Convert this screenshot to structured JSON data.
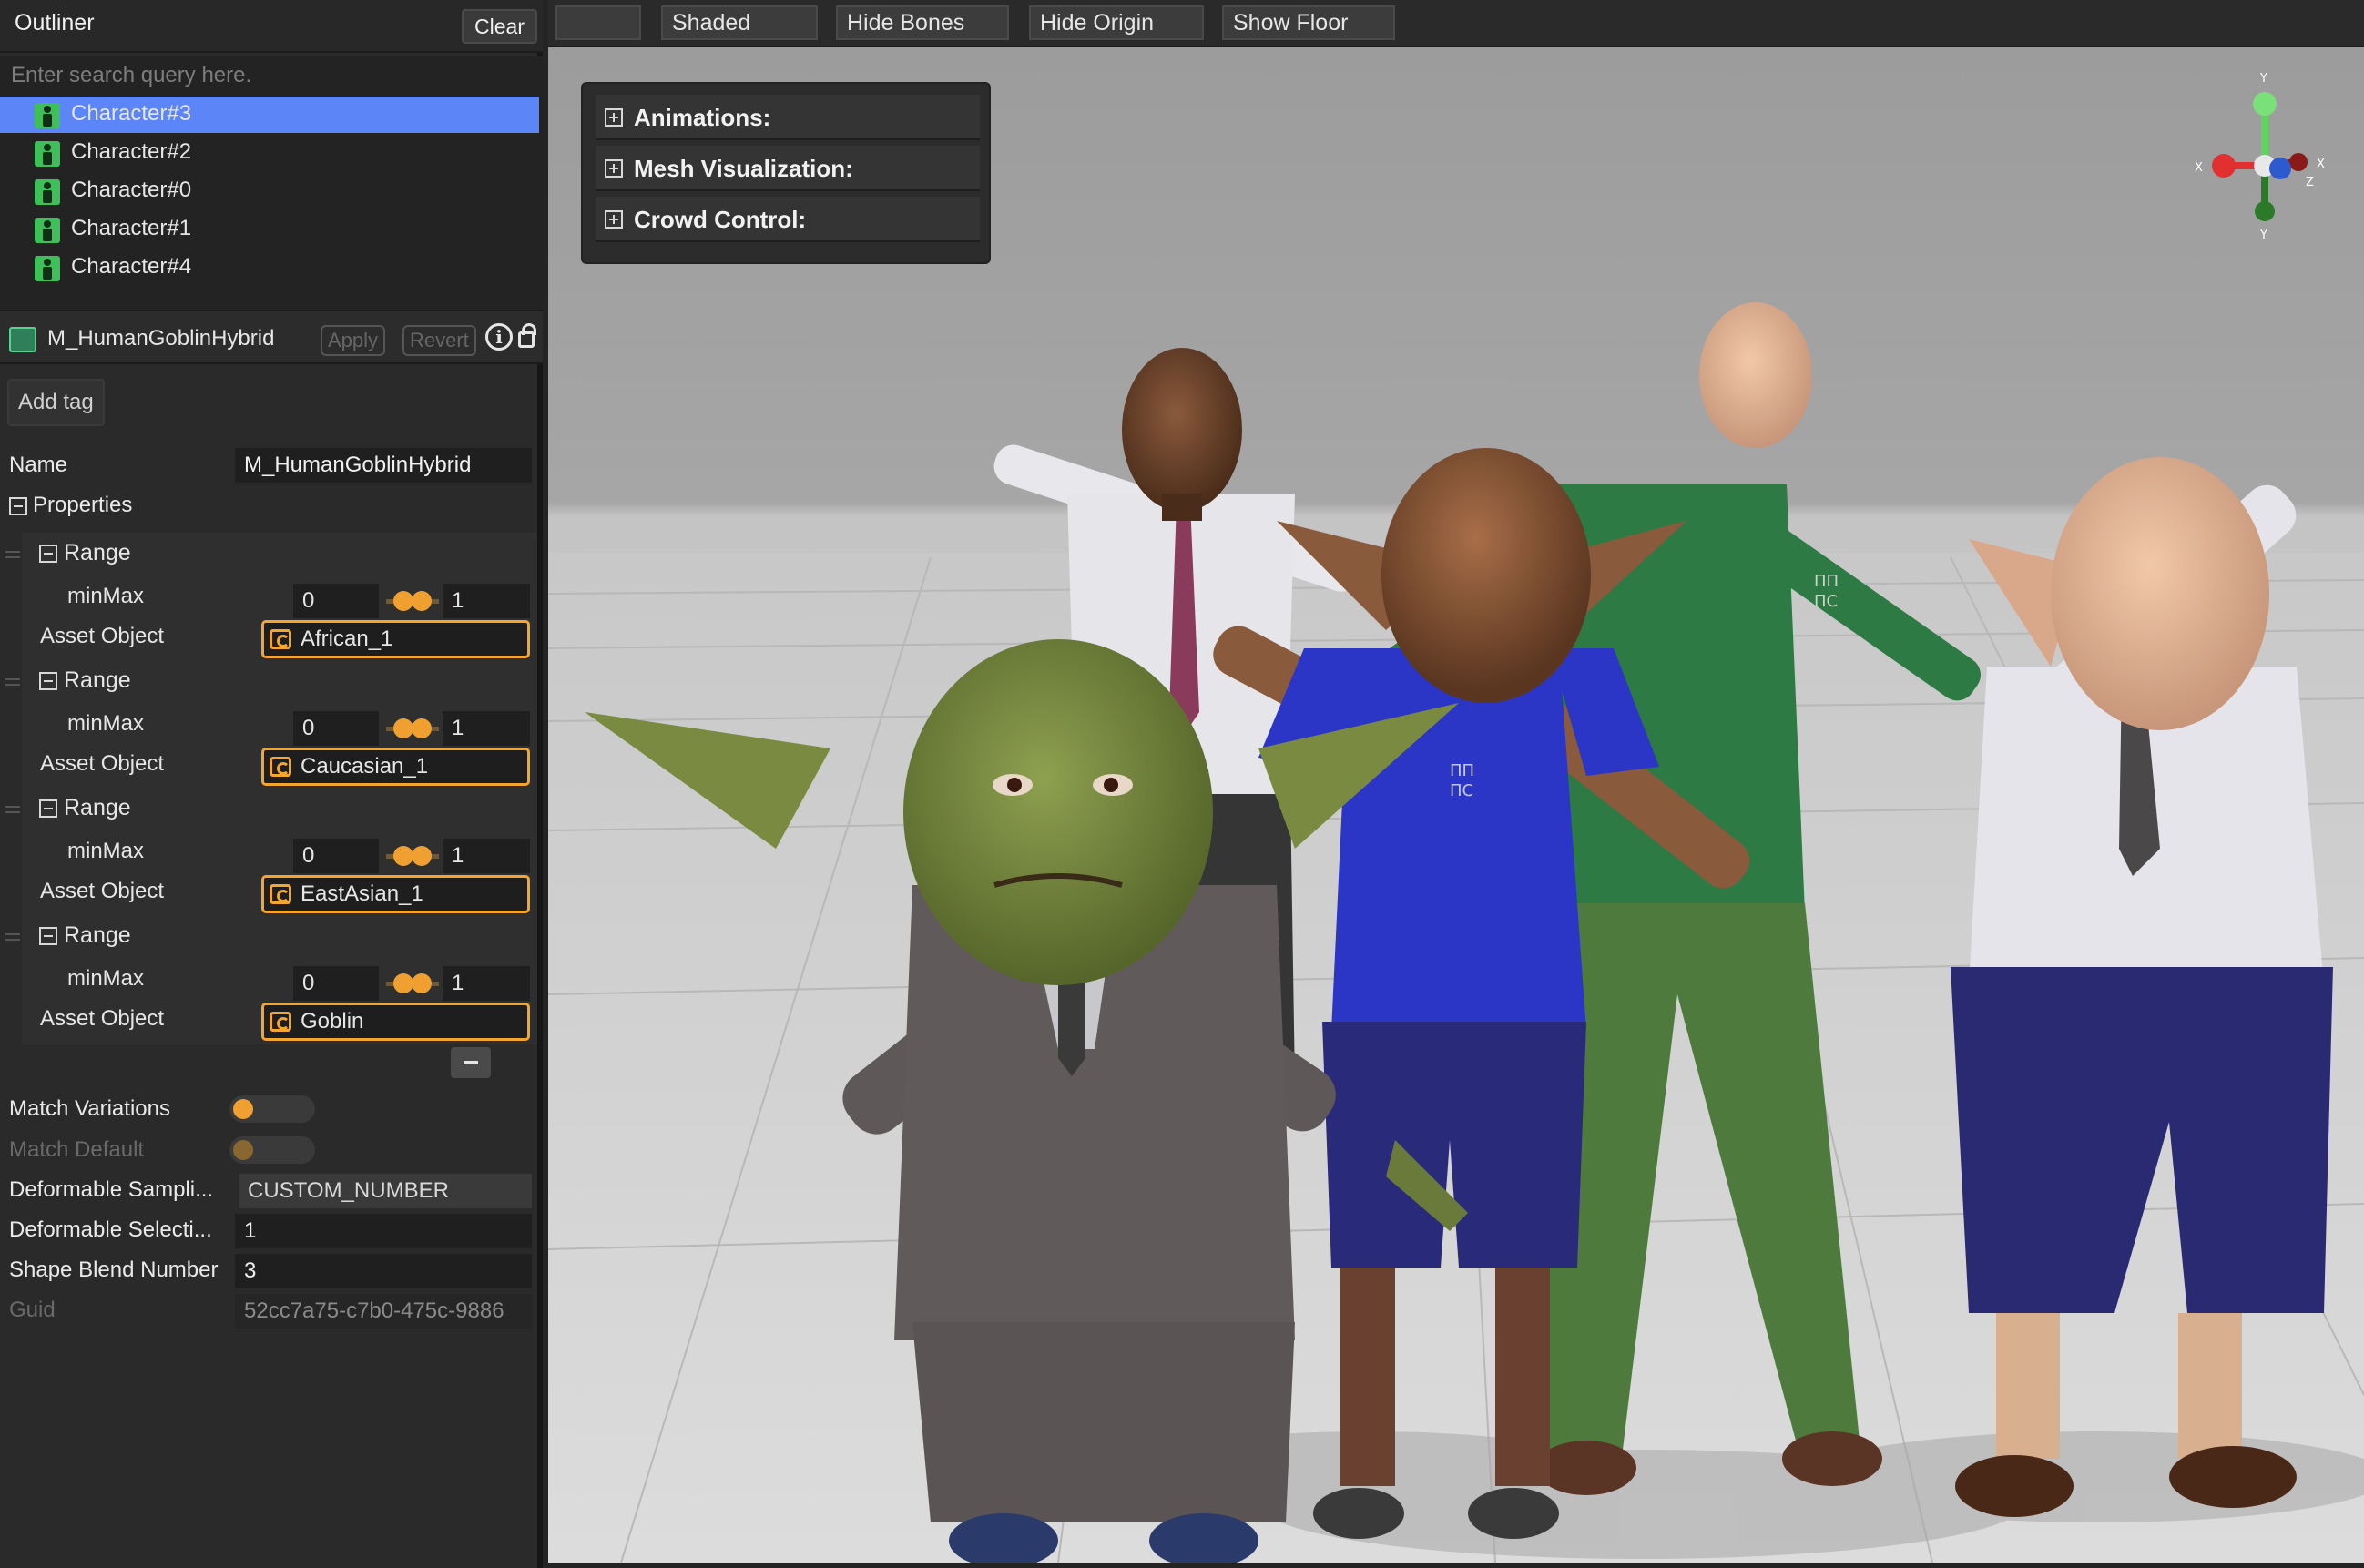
{
  "outliner": {
    "title": "Outliner",
    "clear_label": "Clear",
    "search_placeholder": "Enter search query here.",
    "items": [
      {
        "label": "Character#3",
        "selected": true
      },
      {
        "label": "Character#2",
        "selected": false
      },
      {
        "label": "Character#0",
        "selected": false
      },
      {
        "label": "Character#1",
        "selected": false
      },
      {
        "label": "Character#4",
        "selected": false
      }
    ]
  },
  "inspector": {
    "asset_name": "M_HumanGoblinHybrid",
    "apply_label": "Apply",
    "revert_label": "Revert",
    "add_tag_label": "Add tag",
    "name_label": "Name",
    "name_value": "M_HumanGoblinHybrid",
    "properties_label": "Properties",
    "ranges": [
      {
        "title": "Range",
        "minmax_label": "minMax",
        "min": "0",
        "max": "1",
        "asset_label": "Asset Object",
        "asset_value": "African_1"
      },
      {
        "title": "Range",
        "minmax_label": "minMax",
        "min": "0",
        "max": "1",
        "asset_label": "Asset Object",
        "asset_value": "Caucasian_1"
      },
      {
        "title": "Range",
        "minmax_label": "minMax",
        "min": "0",
        "max": "1",
        "asset_label": "Asset Object",
        "asset_value": "EastAsian_1"
      },
      {
        "title": "Range",
        "minmax_label": "minMax",
        "min": "0",
        "max": "1",
        "asset_label": "Asset Object",
        "asset_value": "Goblin"
      }
    ],
    "match_variations_label": "Match Variations",
    "match_default_label": "Match Default",
    "deformable_sampling_label": "Deformable Sampli...",
    "deformable_sampling_value": "CUSTOM_NUMBER",
    "deformable_selection_label": "Deformable Selecti...",
    "deformable_selection_value": "1",
    "shape_blend_label": "Shape Blend Number",
    "shape_blend_value": "3",
    "guid_label": "Guid",
    "guid_value": "52cc7a75-c7b0-475c-9886"
  },
  "toolbar": {
    "buttons": [
      "",
      "Shaded",
      "Hide Bones",
      "Hide Origin",
      "Show Floor"
    ]
  },
  "viewport": {
    "overlay": [
      "Animations:",
      "Mesh Visualization:",
      "Crowd Control:"
    ],
    "gizmo": {
      "x": "X",
      "y": "Y",
      "z": "Z"
    },
    "shirt_logo": [
      "ΠΠ",
      "ΠC"
    ]
  },
  "colors": {
    "selection": "#5c86f8",
    "accent_orange": "#f3a530",
    "axis_x": "#e23030",
    "axis_y": "#5cd65c",
    "axis_z": "#2e5ad0"
  }
}
